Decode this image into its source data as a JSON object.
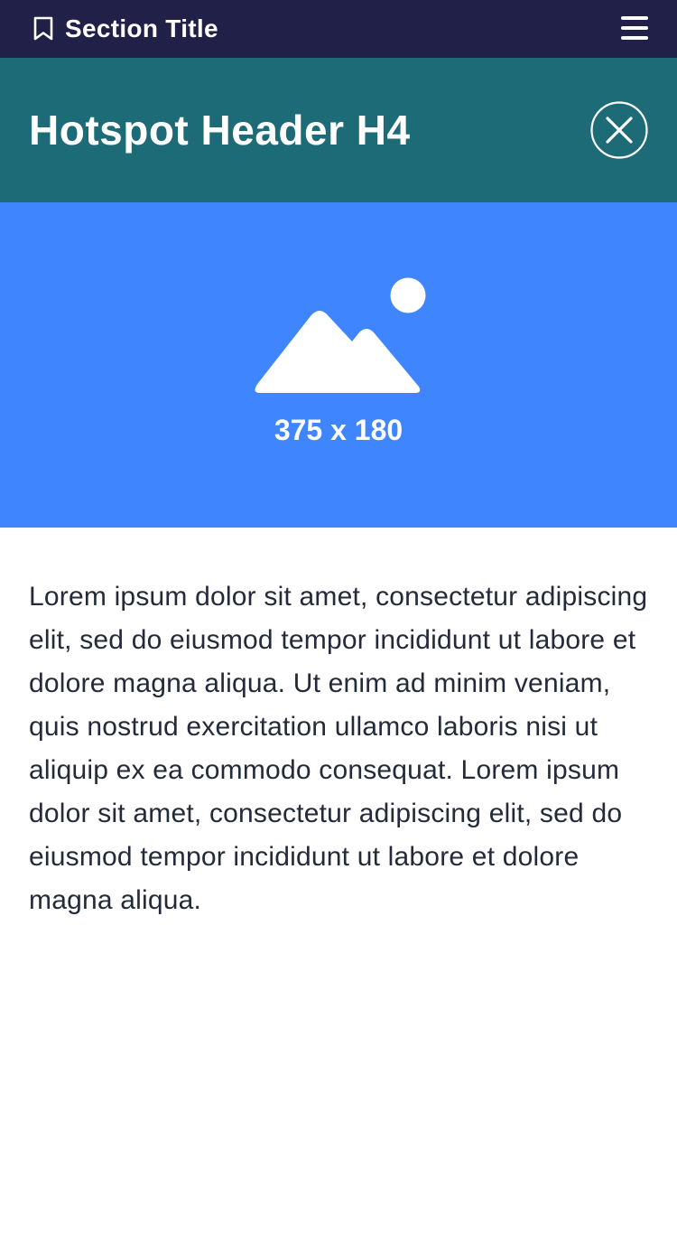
{
  "topbar": {
    "icon": "bookmark-icon",
    "title": "Section Title",
    "menu_icon": "hamburger-menu-icon",
    "background": "#212048"
  },
  "hotspot": {
    "title": "Hotspot Header H4",
    "close_icon": "close-circle-icon",
    "background": "#1c6b77"
  },
  "image": {
    "icon": "image-placeholder-icon",
    "caption": "375 x 180",
    "background": "#3f85fe"
  },
  "body": {
    "text": "Lorem ipsum dolor sit amet, consectetur adipiscing elit, sed do eiusmod tempor incididunt ut labore et dolore magna aliqua. Ut enim ad minim veniam, quis nostrud exercitation ullamco laboris nisi ut aliquip ex ea commodo consequat. Lorem ipsum dolor sit amet, consectetur adipiscing elit, sed do eiusmod tempor incididunt ut labore et dolore magna aliqua.",
    "color": "#232a3a"
  }
}
